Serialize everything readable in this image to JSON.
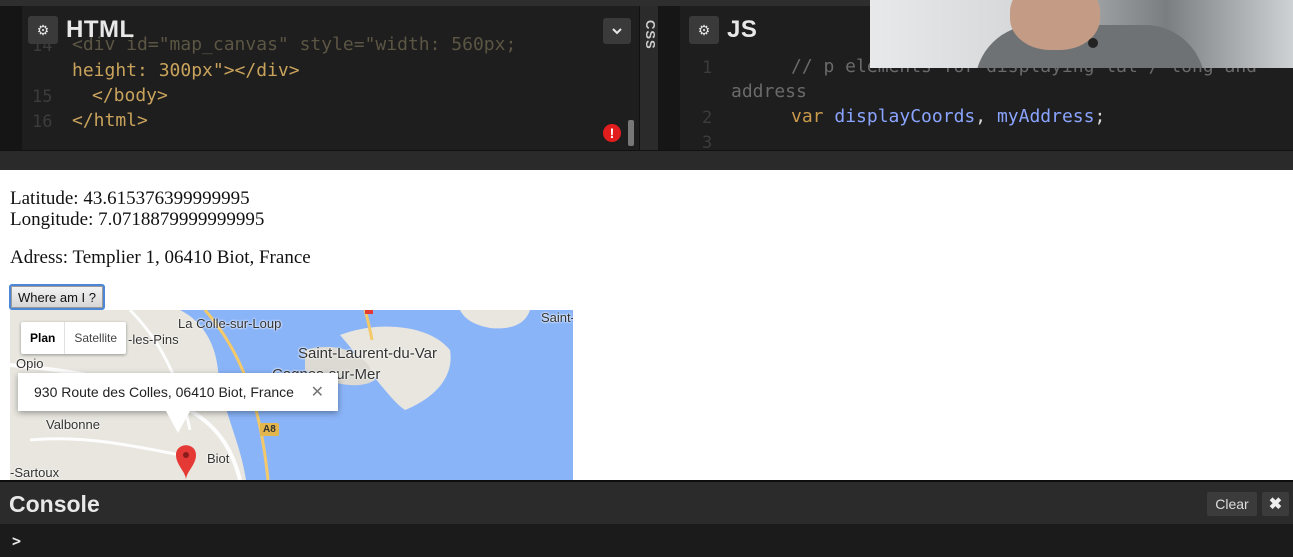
{
  "html_pane": {
    "title": "HTML",
    "gear_icon": "⚙",
    "lines": [
      {
        "num": "14",
        "text": "<div id=\"map_canvas\" style=\"width: 560px;"
      },
      {
        "num": "",
        "text": "height: 300px\"></div>"
      },
      {
        "num": "15",
        "text": "</body>"
      },
      {
        "num": "16",
        "text": "</html>"
      }
    ],
    "error_icon": "!"
  },
  "css_tab": {
    "label": "CSS"
  },
  "js_pane": {
    "title": "JS",
    "gear_icon": "⚙",
    "lines": [
      {
        "num": "1",
        "text": "// p elements for displaying lat / long and"
      },
      {
        "num": "",
        "text": "address"
      },
      {
        "num": "2",
        "text_kw": "var",
        "text_ids": "displayCoords",
        "text_sep": ", ",
        "text_ids2": "myAddress",
        "text_end": ";"
      },
      {
        "num": "3",
        "text": ""
      }
    ]
  },
  "output": {
    "latitude": "Latitude: 43.615376399999995",
    "longitude": "Longitude: 7.0718879999999995",
    "address": "Adress: Templier 1, 06410 Biot, France",
    "button_label": "Where am I ?"
  },
  "map": {
    "tabs": [
      "Plan",
      "Satellite"
    ],
    "infowindow_text": "930 Route des Colles, 06410 Biot, France",
    "infowindow_close": "✕",
    "road_badge": "A8",
    "places": {
      "colle": "La Colle-sur-Loup",
      "pins": "-les-Pins",
      "saint_laurent": "Saint-Laurent-du-Var",
      "cagnes": "Cagnes-sur-Mer",
      "opio": "Opio",
      "valbonne": "Valbonne",
      "biot": "Biot",
      "sartoux": "-Sartoux",
      "saint": "Saint-"
    },
    "colors": {
      "sea": "#8ab4f8",
      "land": "#e8e6df",
      "pin": "#e53935"
    }
  },
  "console": {
    "title": "Console",
    "clear_label": "Clear",
    "close_icon": "✖",
    "prompt": ">"
  }
}
